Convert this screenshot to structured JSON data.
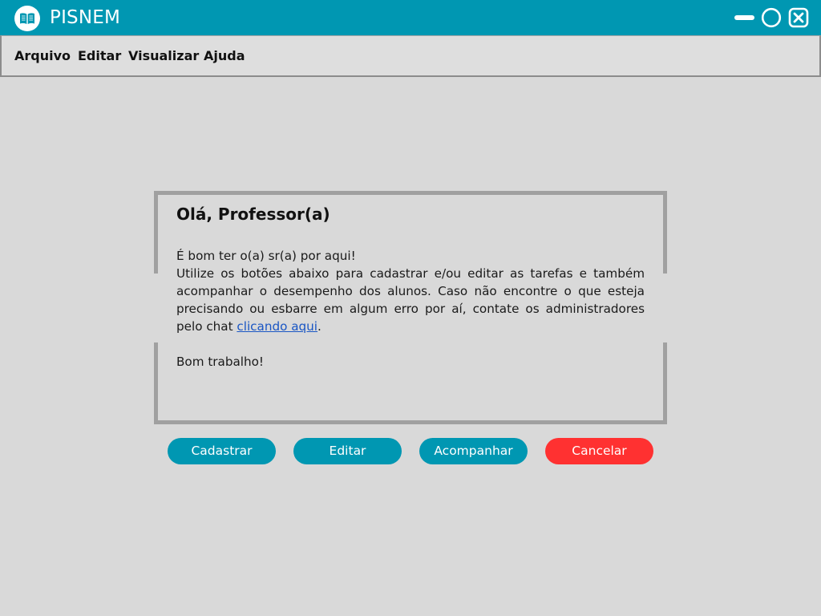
{
  "window": {
    "title": "PISNEM",
    "accent_color": "#0097b2",
    "logo_icon": "open-book-icon",
    "controls": [
      "minimize-icon",
      "maximize-icon",
      "close-icon"
    ]
  },
  "menu": {
    "items": [
      "Arquivo",
      "Editar",
      "Visualizar",
      "Ajuda"
    ]
  },
  "dialog": {
    "title": "Olá, Professor(a)",
    "line1": "É bom ter o(a) sr(a) por aqui!",
    "body_text": "Utilize os botões abaixo para cadastrar e/ou editar as tarefas e também acompanhar o desempenho dos alunos. Caso não encontre o que esteja precisando ou esbarre em algum erro por aí, contate os administradores pelo chat ",
    "link_text": "clicando aqui",
    "body_end": ".",
    "closing": "Bom trabalho!"
  },
  "buttons": {
    "register": "Cadastrar",
    "edit": "Editar",
    "track": "Acompanhar",
    "cancel": "Cancelar",
    "cancel_color": "#ff3131"
  }
}
